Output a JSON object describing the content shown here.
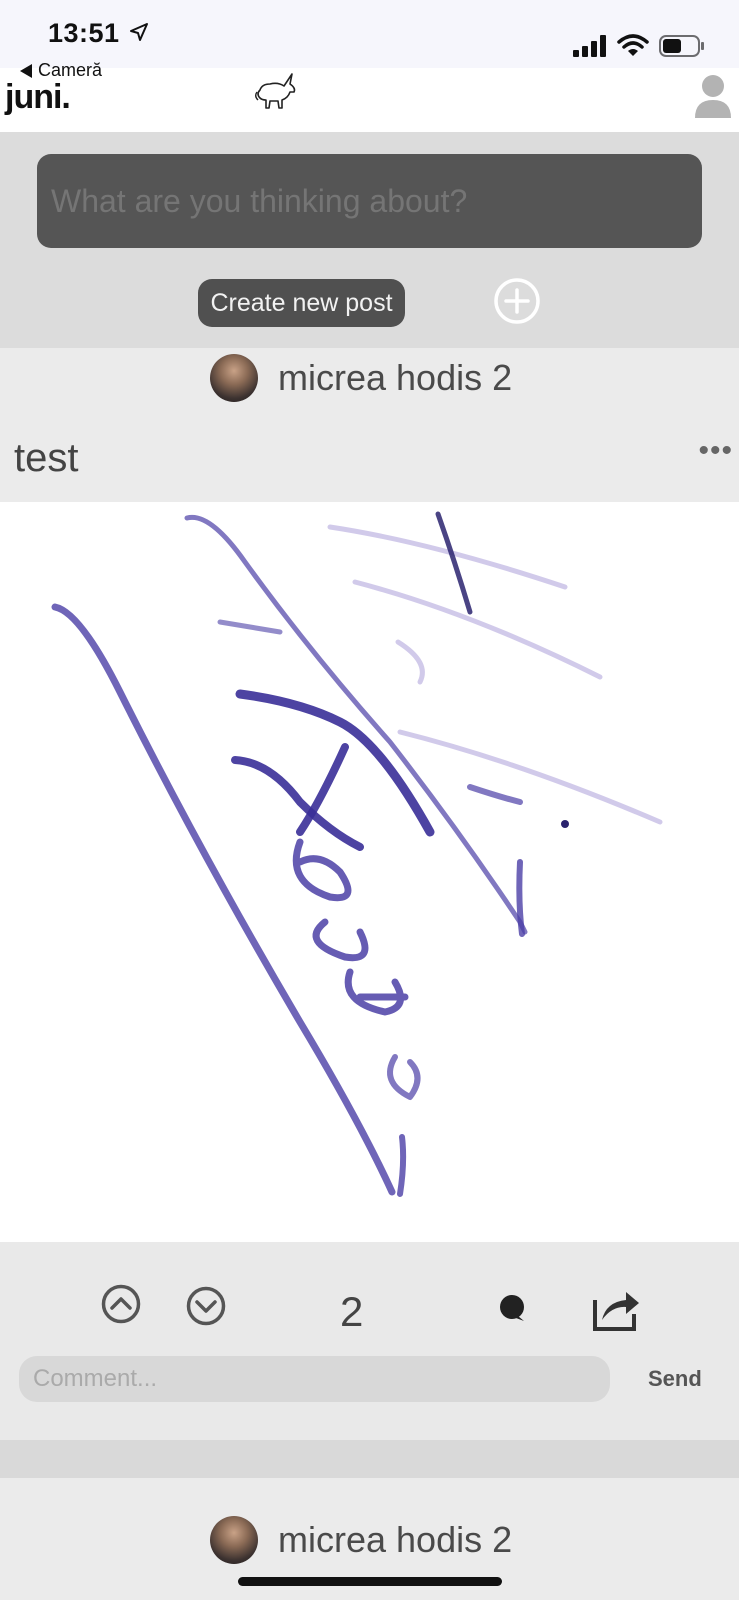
{
  "status_bar": {
    "time": "13:51"
  },
  "header": {
    "back_label": "Cameră",
    "brand": "juni."
  },
  "composer": {
    "placeholder": "What are you thinking about?",
    "create_label": "Create new post"
  },
  "post": {
    "author": "micrea hodis 2",
    "title": "test",
    "menu": "•••",
    "vote_count": "2",
    "comment_placeholder": "Comment...",
    "send_label": "Send"
  },
  "next_post": {
    "author": "micrea hodis 2"
  },
  "colors": {
    "ink": "#4b3fa6",
    "bar_gray": "#dcdcdc",
    "dark_button": "#505050"
  }
}
